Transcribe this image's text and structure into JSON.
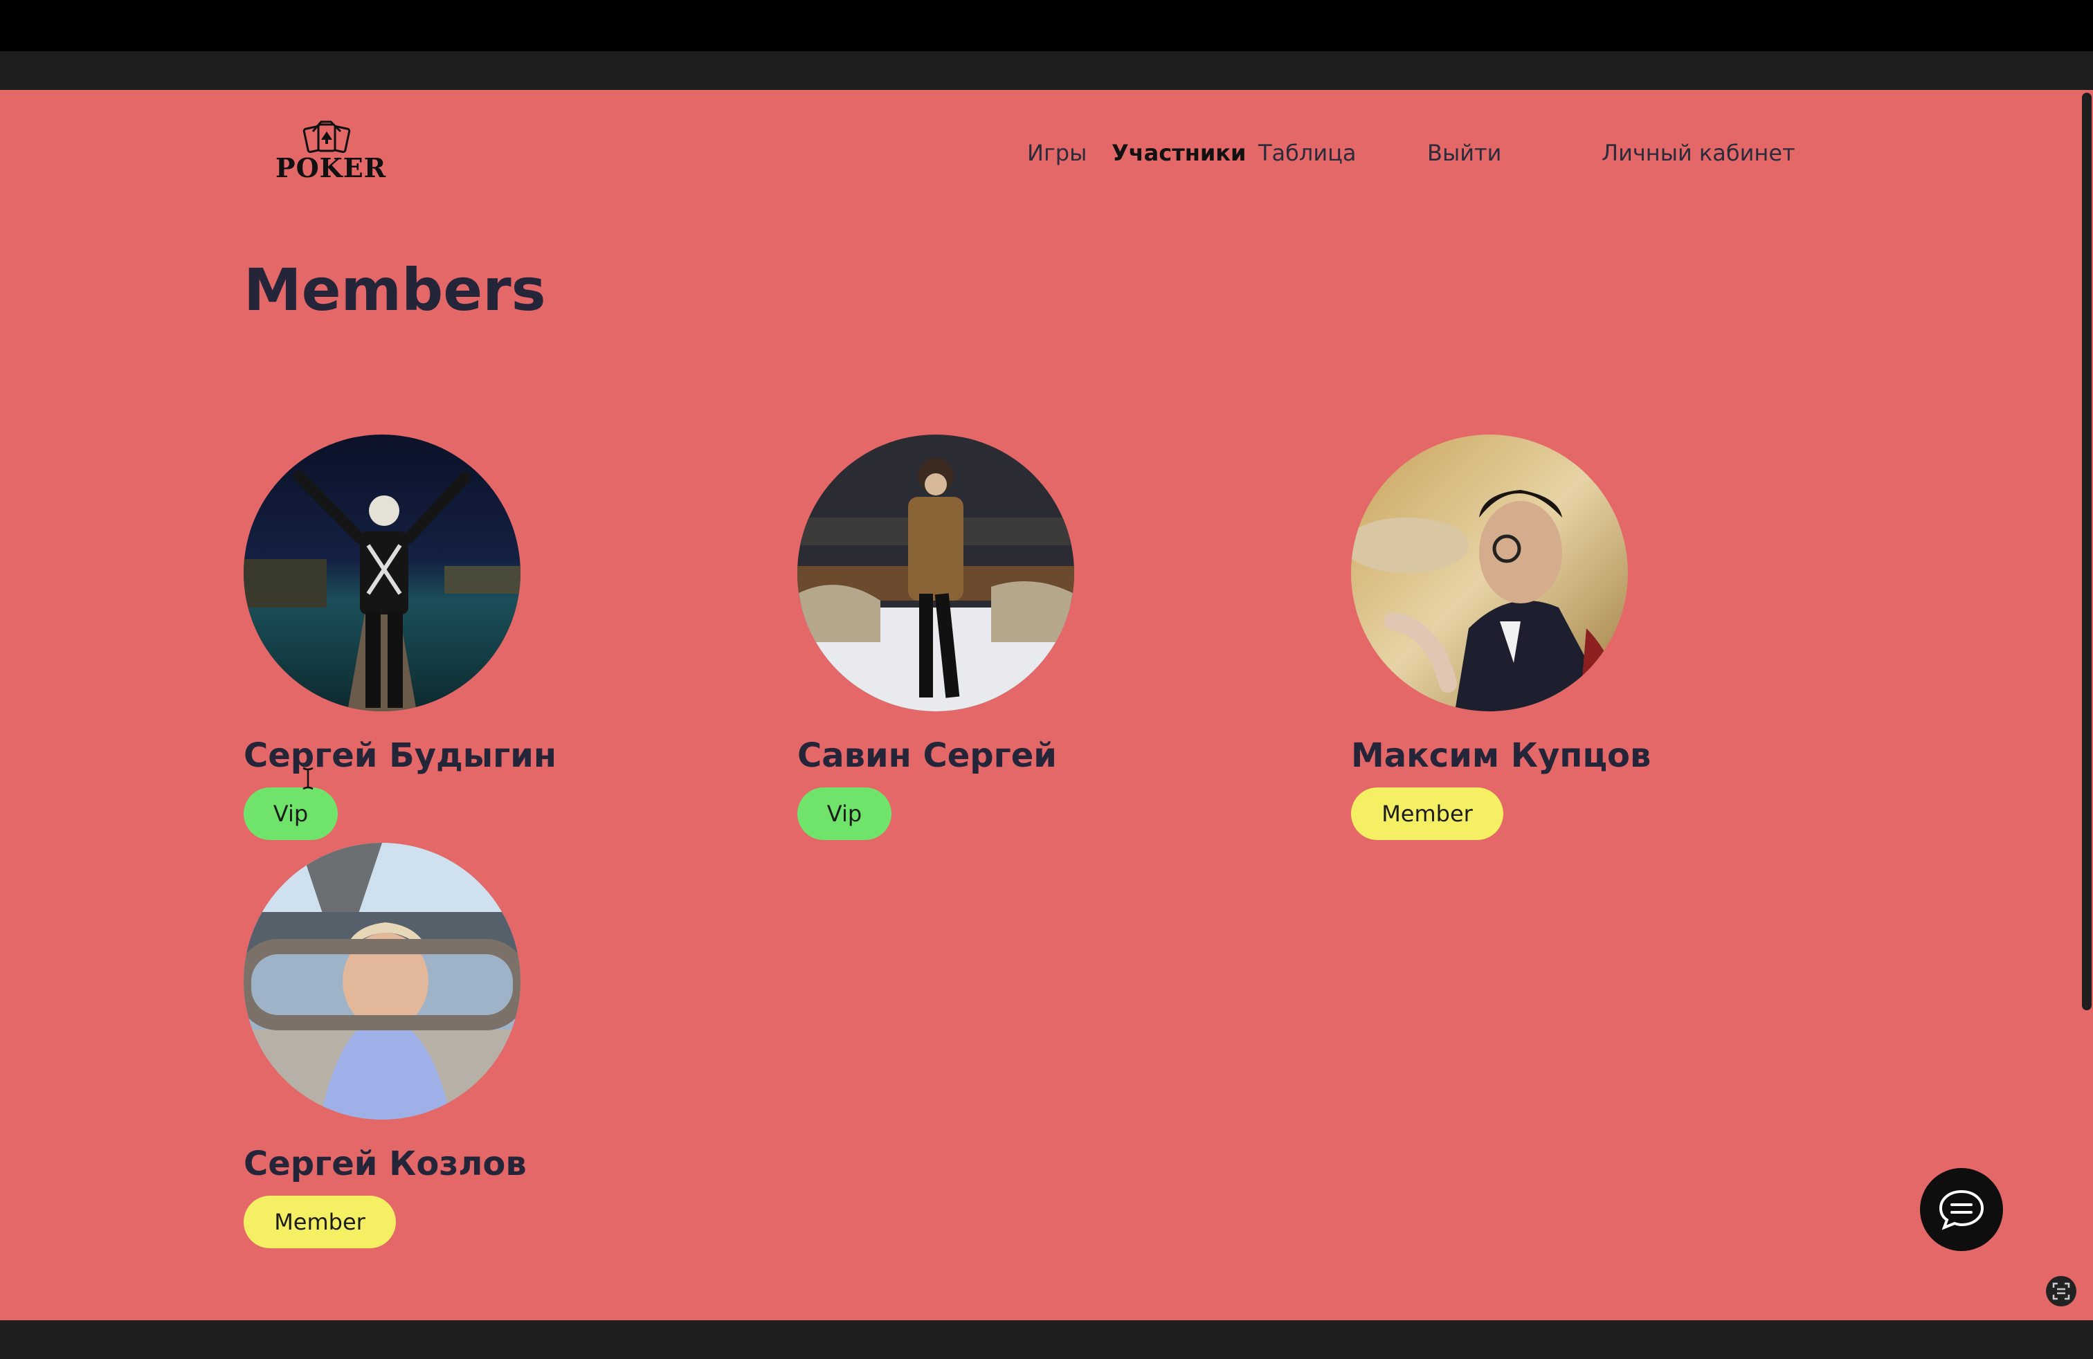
{
  "logo": {
    "text": "POKER"
  },
  "nav": {
    "games": "Игры",
    "members": "Участники",
    "table": "Таблица",
    "logout": "Выйти",
    "cabinet": "Личный кабинет"
  },
  "page_title": "Members",
  "members": [
    {
      "name": "Сергей Будыгин",
      "status": "Vip"
    },
    {
      "name": "Савин Сергей",
      "status": "Vip"
    },
    {
      "name": "Максим Купцов",
      "status": "Member"
    },
    {
      "name": "Сергей Козлов",
      "status": "Member"
    }
  ],
  "colors": {
    "page_background": "#e46868",
    "vip_badge": "#6fe36a",
    "member_badge": "#f4ef63",
    "text_dark": "#25253a"
  },
  "icons": {
    "chat": "chat-bubble-icon",
    "corner": "screen-capture-icon",
    "logo": "poker-cards-icon"
  }
}
